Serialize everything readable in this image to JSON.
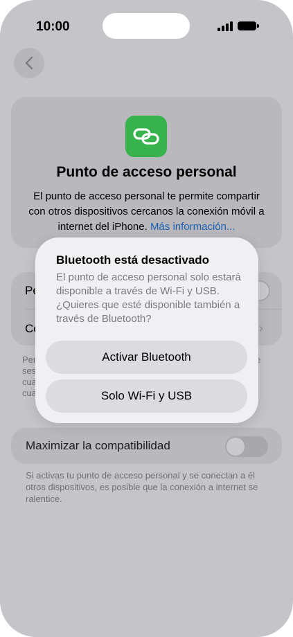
{
  "status_bar": {
    "time": "10:00"
  },
  "hero": {
    "title": "Punto de acceso personal",
    "description": "El punto de acceso personal te permite compartir con otros dispositivos cercanos la conexión móvil a internet del iPhone.",
    "link": "Más información...",
    "icon_color": "#37b24d"
  },
  "settings": {
    "row1_label_partial": "Pe",
    "row2_label_partial": "Co",
    "footer_partial": [
      "Per",
      "ses",
      "cua",
      "cua"
    ],
    "footer_right_partial": "e"
  },
  "compatibility": {
    "label": "Maximizar la compatibilidad",
    "toggle_on": false,
    "note": "Si activas tu punto de acceso personal y se conectan a él otros dispositivos, es posible que la conexión a internet se ralentice."
  },
  "dialog": {
    "title": "Bluetooth está desactivado",
    "body": "El punto de acceso personal solo estará disponible a través de Wi-Fi y USB. ¿Quieres que esté disponible también a través de Bluetooth?",
    "buttons": [
      "Activar Bluetooth",
      "Solo Wi-Fi y USB"
    ]
  }
}
